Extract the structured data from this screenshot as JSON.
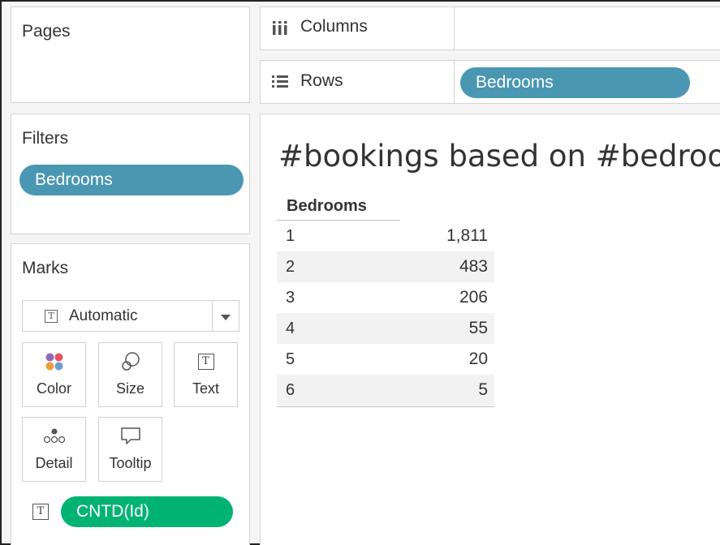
{
  "pages": {
    "title": "Pages"
  },
  "shelves": {
    "columns": {
      "label": "Columns"
    },
    "rows": {
      "label": "Rows",
      "pill": "Bedrooms"
    }
  },
  "filters": {
    "title": "Filters",
    "pill": "Bedrooms"
  },
  "marks": {
    "title": "Marks",
    "type": "Automatic",
    "buttons": {
      "color": "Color",
      "size": "Size",
      "text": "Text",
      "detail": "Detail",
      "tooltip": "Tooltip"
    },
    "field": "CNTD(Id)",
    "icon_glyph": "T"
  },
  "view": {
    "title": "#bookings based on #bedrooms",
    "header": "Bedrooms",
    "rows": [
      {
        "key": "1",
        "value": "1,811"
      },
      {
        "key": "2",
        "value": "483"
      },
      {
        "key": "3",
        "value": "206"
      },
      {
        "key": "4",
        "value": "55"
      },
      {
        "key": "5",
        "value": "20"
      },
      {
        "key": "6",
        "value": "5"
      }
    ]
  },
  "colors": {
    "dimension": "#4a97b3",
    "measure": "#00b374"
  }
}
